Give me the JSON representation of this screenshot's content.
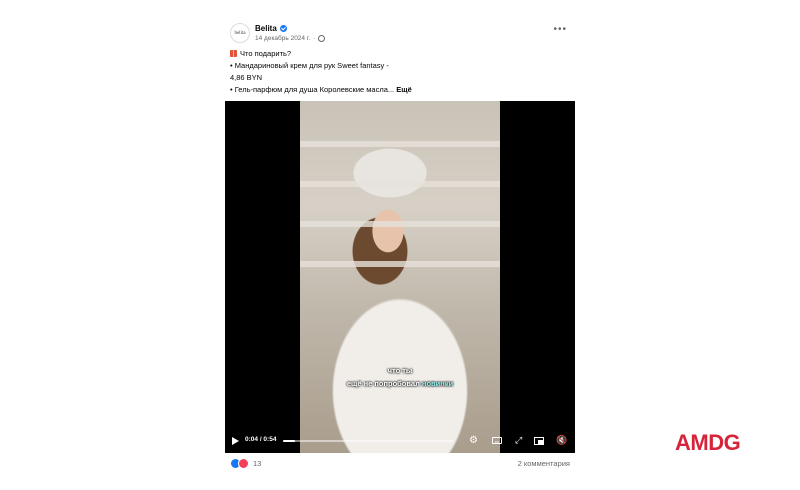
{
  "post": {
    "author": "Belita",
    "avatar_text": "belita",
    "date": "14 декабрь 2024 г.",
    "more_icon": "ellipsis-icon",
    "text_lines": [
      "Что подарить?",
      "• Мандариновый крем для рук Sweet fantasy -",
      "4,86 BYN",
      "• Гель-парфюм для душа Королевские масла..."
    ],
    "see_more": "Ещё"
  },
  "video": {
    "subtitle_line1": "что ты",
    "subtitle_line2_a": "ещё не попробовал ",
    "subtitle_line2_b": "новинки",
    "time": "0:04 / 0:54",
    "progress": 0.07
  },
  "footer": {
    "reaction_count": "13",
    "comments": "2 комментария"
  },
  "brand": "AMDG",
  "colors": {
    "accent": "#1877f2",
    "brand": "#d6243a",
    "love": "#f33e58"
  }
}
